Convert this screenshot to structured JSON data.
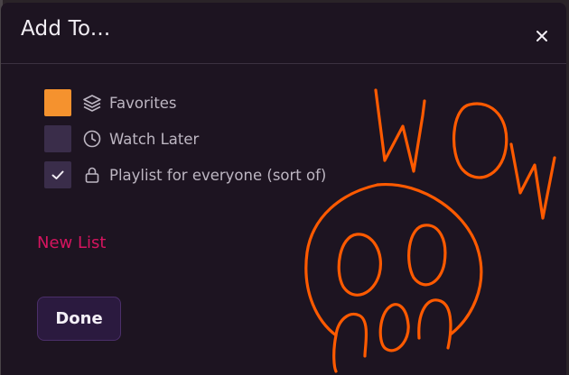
{
  "dialog": {
    "title": "Add To...",
    "close_icon": "close-icon"
  },
  "options": [
    {
      "label": "Favorites",
      "icon": "layers-icon",
      "checked": false,
      "checkbox_color": "#f5922e"
    },
    {
      "label": "Watch Later",
      "icon": "clock-icon",
      "checked": false,
      "checkbox_color": "#3a2d4a"
    },
    {
      "label": "Playlist for everyone (sort of)",
      "icon": "lock-icon",
      "checked": true,
      "checkbox_color": "#3a2d4a"
    }
  ],
  "new_list_label": "New List",
  "done_label": "Done",
  "doodle": {
    "text": "WOW",
    "color": "#ff5a00"
  },
  "colors": {
    "modal_bg": "#1d1421",
    "accent_link": "#d6145f",
    "done_bg": "#2b1a3f"
  }
}
